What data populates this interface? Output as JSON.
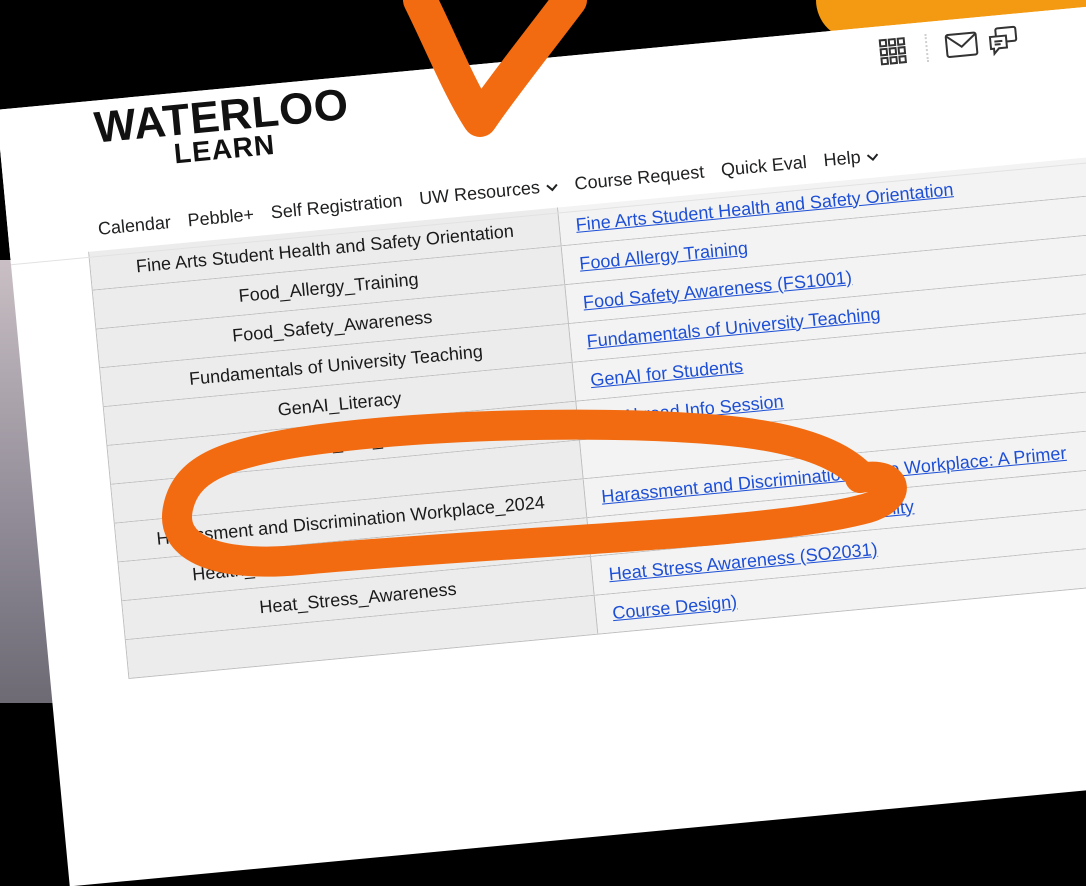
{
  "header": {
    "logo_line1": "WATERLOO",
    "logo_line2": "LEARN"
  },
  "icons": {
    "apps": "grid-icon",
    "mail": "mail-icon",
    "chat": "chat-icon"
  },
  "nav": {
    "items": [
      {
        "label": "Calendar"
      },
      {
        "label": "Pebble+"
      },
      {
        "label": "Self Registration"
      },
      {
        "label": "UW Resources",
        "has_dropdown": true
      },
      {
        "label": "Course Request"
      },
      {
        "label": "Quick Eval"
      },
      {
        "label": "Help",
        "has_dropdown": true
      }
    ]
  },
  "table": {
    "rows": [
      {
        "code": "Fine Arts Student Health and Safety Orientation",
        "title": "Fine Arts Student Health and Safety Orientation"
      },
      {
        "code": "Food_Allergy_Training",
        "title": "Food Allergy Training"
      },
      {
        "code": "Food_Safety_Awareness",
        "title": "Food Safety Awareness (FS1001)"
      },
      {
        "code": "Fundamentals of University Teaching",
        "title": "Fundamentals of University Teaching"
      },
      {
        "code": "GenAI_Literacy",
        "title": "GenAI for Students"
      },
      {
        "code": "Go_Abroad_Info_Session",
        "title": "Go Abroad Info Session"
      },
      {
        "code": "",
        "title": ""
      },
      {
        "code": "Harassment and Discrimination Workplace_2024",
        "title": "Harassment and Discrimination in the Workplace: A Primer"
      },
      {
        "code": "Health_Humanities_Student_Community",
        "title": "Health Humanities Student Community"
      },
      {
        "code": "Heat_Stress_Awareness",
        "title": "Heat Stress Awareness (SO2031)"
      },
      {
        "code": "",
        "title": "Course Design)"
      }
    ]
  },
  "colors": {
    "annotation": "#f26b10",
    "link": "#1d4fd6",
    "corner": "#f39a12"
  }
}
